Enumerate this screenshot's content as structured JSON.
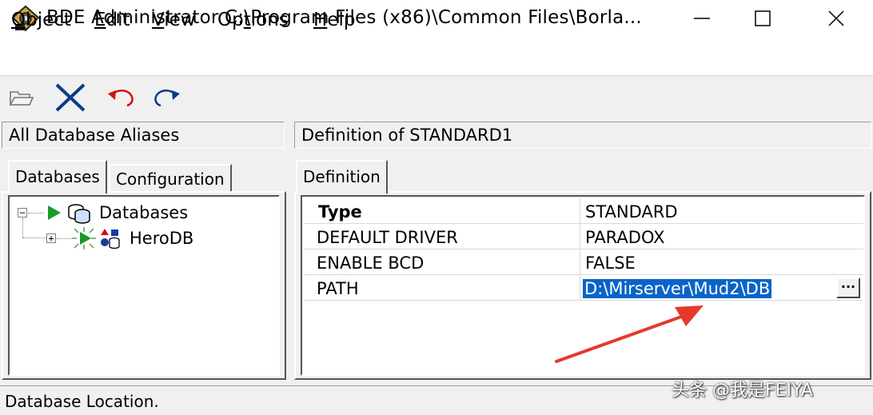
{
  "window": {
    "title": "BDE Administrator  C:\\Program Files (x86)\\Common Files\\Borla..."
  },
  "menu": [
    {
      "key": "O",
      "rest": "bject"
    },
    {
      "key": "E",
      "rest": "dit"
    },
    {
      "key": "V",
      "rest": "iew"
    },
    {
      "pre": "Op",
      "key": "t",
      "rest": "ions"
    },
    {
      "key": "H",
      "rest": "elp"
    }
  ],
  "left_panel": {
    "header": "All Database Aliases",
    "tabs": [
      "Databases",
      "Configuration"
    ],
    "tree": [
      {
        "label": "Databases",
        "expander": "−"
      },
      {
        "label": "HeroDB",
        "expander": "+"
      }
    ]
  },
  "right_panel": {
    "header": "Definition of STANDARD1",
    "tab": "Definition",
    "rows": [
      {
        "name": "Type",
        "value": "STANDARD"
      },
      {
        "name": "DEFAULT DRIVER",
        "value": "PARADOX"
      },
      {
        "name": "ENABLE BCD",
        "value": "FALSE"
      },
      {
        "name": "PATH",
        "value": "D:\\Mirserver\\Mud2\\DB"
      }
    ],
    "browse_label": "..."
  },
  "status": {
    "text": "Database Location."
  },
  "watermark": "头条 @我是FEIYA",
  "colors": {
    "selection": "#0a64c8",
    "arrow": "#e53a2a",
    "tree_arrow": "#1a9a2a"
  }
}
